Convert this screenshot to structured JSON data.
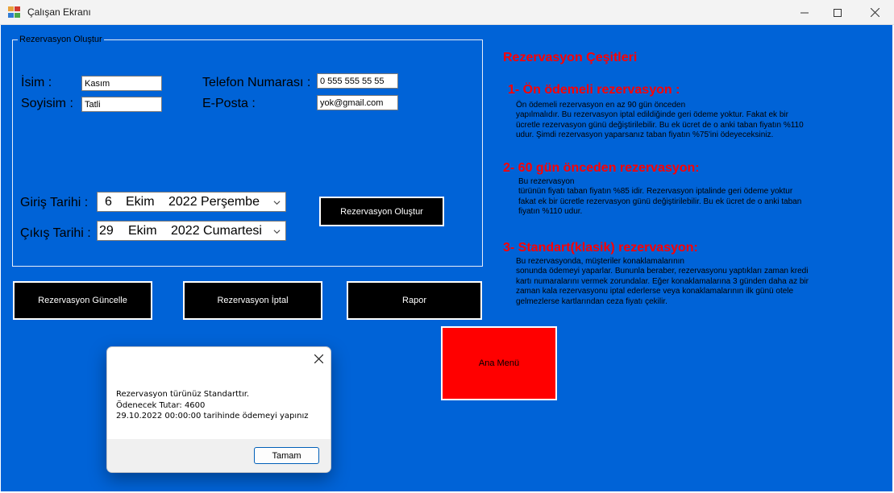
{
  "window": {
    "title": "Çalışan Ekranı",
    "minimize": "—",
    "maximize": "☐",
    "close": "✕"
  },
  "group": {
    "title": "Rezervasyon Oluştur"
  },
  "form": {
    "name_label": "İsim :",
    "name_value": "Kasım",
    "surname_label": "Soyisim :",
    "surname_value": "Tatli",
    "phone_label": "Telefon Numarası :",
    "phone_value": "0 555 555 55 55",
    "email_label": "E-Posta :",
    "email_value": "yok@gmail.com",
    "checkin_label": "Giriş Tarihi :",
    "checkin_day": "6",
    "checkin_month": "Ekim",
    "checkin_rest": "2022 Perşembe",
    "checkout_label": "Çıkış Tarihi :",
    "checkout_day": "29",
    "checkout_month": "Ekim",
    "checkout_rest": "2022 Cumartesi",
    "create_button": "Rezervasyon Oluştur"
  },
  "actions": {
    "update_button": "Rezervasyon Güncelle",
    "cancel_button": "Rezervasyon İptal",
    "report_button": "Rapor",
    "main_menu_button": "Ana Menü"
  },
  "info": {
    "title": "Rezervasyon Çeşitleri",
    "type1_title": "1-  Ön ödemeli rezervasyon :",
    "type1_desc": "Ön ödemeli rezervasyon en az 90 gün önceden\nyapılmalıdır. Bu rezervasyon iptal edildiğinde geri ödeme yoktur. Fakat ek bir\nücretle rezervasyon günü değiştirilebilir. Bu ek ücret de o anki taban fiyatın %110\nudur. Şimdi rezervasyon yaparsanız taban fiyatın %75'ini ödeyeceksiniz.",
    "type2_title": "2- 60 gün önceden rezervasyon:",
    "type2_desc": "Bu rezervasyon\ntürünün fiyatı taban fiyatın %85 idir. Rezervasyon iptalinde geri ödeme yoktur\nfakat ek bir ücretle rezervasyon günü değiştirilebilir. Bu ek ücret de o anki taban\nfiyatın %110 udur.",
    "type3_title": "3- Standart(klasik) rezervasyon:",
    "type3_desc": "Bu rezervasyonda, müşteriler konaklamalarının\nsonunda ödemeyi yaparlar. Bununla beraber, rezervasyonu yaptıkları zaman kredi\nkartı numaralarını vermek zorundalar. Eğer konaklamalarına 3 günden daha az bir\nzaman kala rezervasyonu iptal ederlerse veya konaklamalarının ilk günü otele\ngelmezlerse kartlarından ceza fiyatı çekilir."
  },
  "messagebox": {
    "line1": "Rezervasyon türünüz Standarttır.",
    "line2": "Ödenecek Tutar: 4600",
    "line3": "29.10.2022 00:00:00 tarihinde ödemeyi yapınız",
    "ok_button": "Tamam"
  },
  "colors": {
    "form_background": "#0063d7",
    "heading_red": "#ff0000",
    "button_black": "#000000"
  }
}
